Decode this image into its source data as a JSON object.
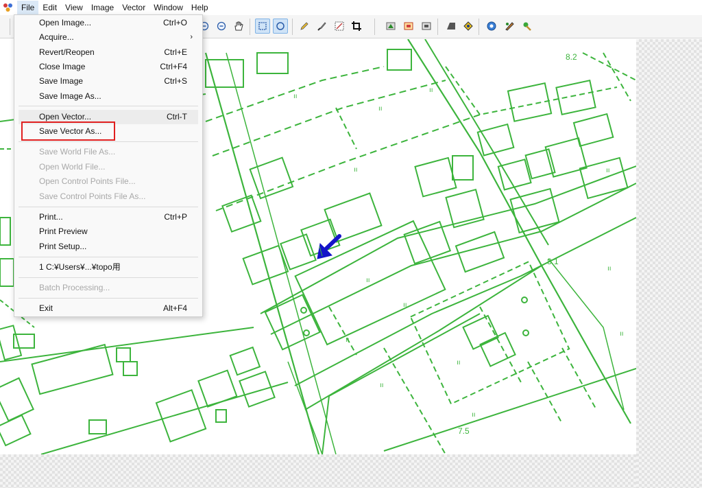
{
  "menubar": {
    "items": [
      "File",
      "Edit",
      "View",
      "Image",
      "Vector",
      "Window",
      "Help"
    ]
  },
  "file_menu": {
    "groups": [
      [
        {
          "label": "Open Image...",
          "shortcut": "Ctrl+O",
          "enabled": true
        },
        {
          "label": "Acquire...",
          "shortcut": "",
          "enabled": true,
          "submenu": true
        },
        {
          "label": "Revert/Reopen",
          "shortcut": "Ctrl+E",
          "enabled": true
        },
        {
          "label": "Close Image",
          "shortcut": "Ctrl+F4",
          "enabled": true
        },
        {
          "label": "Save Image",
          "shortcut": "Ctrl+S",
          "enabled": true
        },
        {
          "label": "Save Image As...",
          "shortcut": "",
          "enabled": true
        }
      ],
      [
        {
          "label": "Open Vector...",
          "shortcut": "Ctrl-T",
          "enabled": true,
          "hovered": true
        },
        {
          "label": "Save Vector As...",
          "shortcut": "",
          "enabled": true,
          "highlighted": true
        }
      ],
      [
        {
          "label": "Save World File As...",
          "shortcut": "",
          "enabled": false
        },
        {
          "label": "Open World File...",
          "shortcut": "",
          "enabled": false
        },
        {
          "label": "Open Control Points File...",
          "shortcut": "",
          "enabled": false
        },
        {
          "label": "Save Control Points File As...",
          "shortcut": "",
          "enabled": false
        }
      ],
      [
        {
          "label": "Print...",
          "shortcut": "Ctrl+P",
          "enabled": true
        },
        {
          "label": "Print Preview",
          "shortcut": "",
          "enabled": true
        },
        {
          "label": "Print Setup...",
          "shortcut": "",
          "enabled": true
        }
      ],
      [
        {
          "label": "1 C:¥Users¥...¥topo用",
          "shortcut": "",
          "enabled": true
        }
      ],
      [
        {
          "label": "Batch Processing...",
          "shortcut": "",
          "enabled": false
        }
      ],
      [
        {
          "label": "Exit",
          "shortcut": "Alt+F4",
          "enabled": true
        }
      ]
    ]
  },
  "map": {
    "elevations": [
      "8.2",
      "8.1",
      "7.5"
    ],
    "line_color": "#3cb43c",
    "arrow_color": "#1414c8"
  },
  "toolbar": {
    "icons": [
      "zoom-in-icon",
      "zoom-out-icon",
      "pan-hand-icon",
      "select-rect-icon",
      "select-ellipse-icon",
      "pencil-icon",
      "brush-icon",
      "edit-vertex-icon",
      "crop-icon",
      "layer-icon-1",
      "layer-icon-2",
      "layer-icon-3",
      "fill-icon",
      "color-icon",
      "export-icon",
      "settings-icon",
      "tool-icon"
    ]
  }
}
